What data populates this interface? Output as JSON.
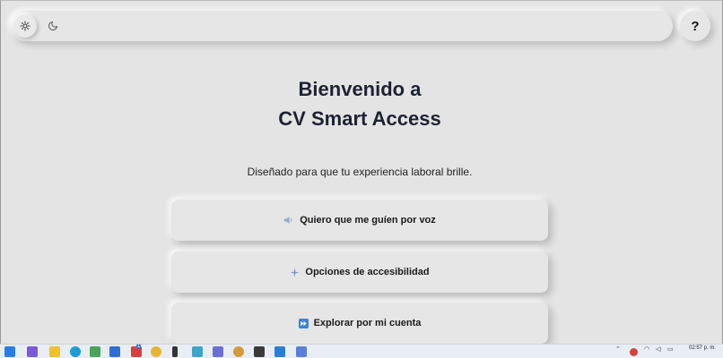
{
  "header": {
    "light_mode_icon": "sun-icon",
    "dark_mode_icon": "moon-icon",
    "help_label": "?"
  },
  "hero": {
    "title_line1": "Bienvenido a",
    "title_line2": "CV Smart Access",
    "subtitle": "Diseñado para que tu experiencia laboral brille."
  },
  "options": [
    {
      "icon": "speaker-icon",
      "label": "Quiero que me guíen por voz"
    },
    {
      "icon": "sparkle-icon",
      "label": "Opciones de accesibilidad"
    },
    {
      "icon": "fast-forward-icon",
      "label": "Explorar por mi cuenta"
    }
  ],
  "taskbar": {
    "clock_time": "02:57 p. m.",
    "notification_badge": "1"
  },
  "colors": {
    "background": "#e4e4e4",
    "title_text": "#1e2232",
    "taskbar": "#e9eef5"
  }
}
